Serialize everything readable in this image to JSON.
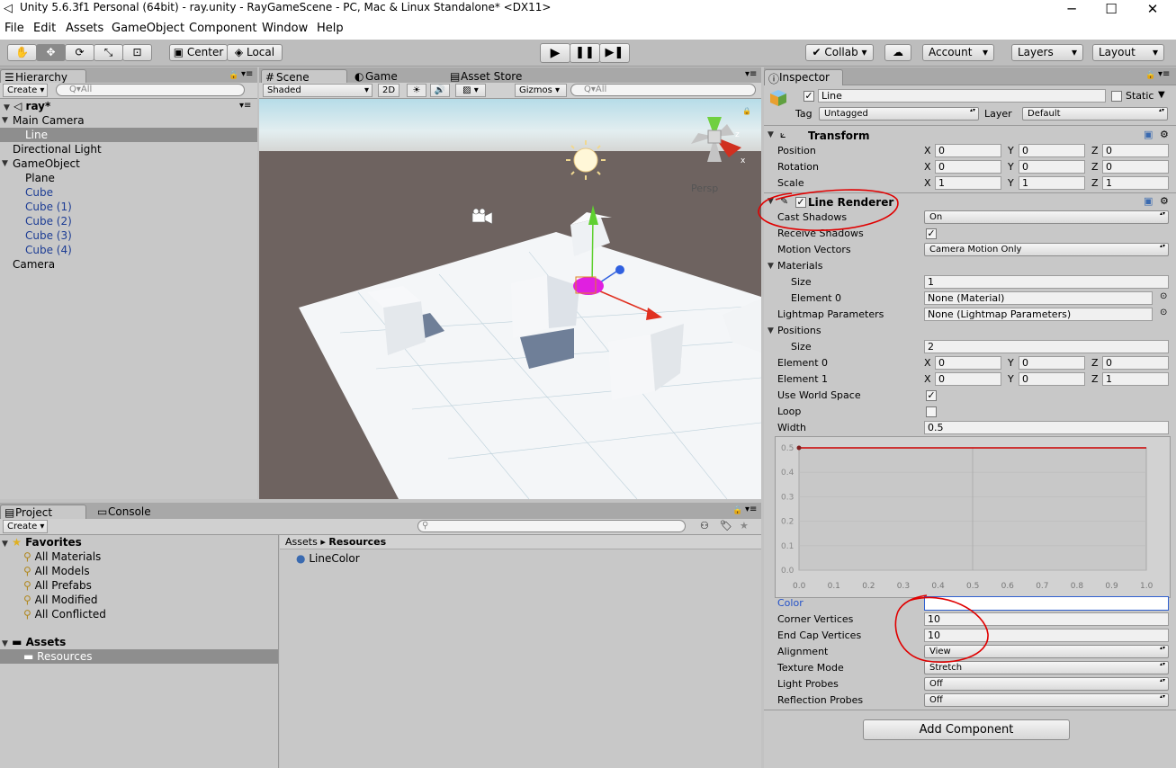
{
  "window": {
    "title": "Unity 5.6.3f1 Personal (64bit) - ray.unity - RayGameScene - PC, Mac & Linux Standalone* <DX11>",
    "minimize": "─",
    "maximize": "☐",
    "close": "✕"
  },
  "menu": [
    "File",
    "Edit",
    "Assets",
    "GameObject",
    "Component",
    "Window",
    "Help"
  ],
  "toolbar": {
    "center": "Center",
    "local": "Local",
    "collab": "Collab",
    "account": "Account",
    "layers": "Layers",
    "layout": "Layout"
  },
  "hierarchy": {
    "tab": "Hierarchy",
    "create": "Create",
    "search_placeholder": "Q▾All",
    "scene": "ray*",
    "items": [
      {
        "label": "Main Camera",
        "indent": 0,
        "expand": "open",
        "prefab": false,
        "selected": false
      },
      {
        "label": "Line",
        "indent": 1,
        "expand": "none",
        "prefab": false,
        "selected": true
      },
      {
        "label": "Directional Light",
        "indent": 0,
        "expand": "none",
        "prefab": false,
        "selected": false
      },
      {
        "label": "GameObject",
        "indent": 0,
        "expand": "open",
        "prefab": false,
        "selected": false
      },
      {
        "label": "Plane",
        "indent": 1,
        "expand": "none",
        "prefab": false,
        "selected": false
      },
      {
        "label": "Cube",
        "indent": 1,
        "expand": "none",
        "prefab": true,
        "selected": false
      },
      {
        "label": "Cube (1)",
        "indent": 1,
        "expand": "none",
        "prefab": true,
        "selected": false
      },
      {
        "label": "Cube (2)",
        "indent": 1,
        "expand": "none",
        "prefab": true,
        "selected": false
      },
      {
        "label": "Cube (3)",
        "indent": 1,
        "expand": "none",
        "prefab": true,
        "selected": false
      },
      {
        "label": "Cube (4)",
        "indent": 1,
        "expand": "none",
        "prefab": true,
        "selected": false
      },
      {
        "label": "Camera",
        "indent": 0,
        "expand": "none",
        "prefab": false,
        "selected": false
      }
    ]
  },
  "scene_tabs": {
    "scene": "Scene",
    "game": "Game",
    "asset_store": "Asset Store",
    "shaded": "Shaded",
    "mode_2d": "2D",
    "gizmos": "Gizmos",
    "search_placeholder": "Q▾All",
    "persp": "Persp",
    "gizmo_x": "x",
    "gizmo_z": "z"
  },
  "project": {
    "tab": "Project",
    "console_tab": "Console",
    "create": "Create",
    "favorites": "Favorites",
    "fav_items": [
      "All Materials",
      "All Models",
      "All Prefabs",
      "All Modified",
      "All Conflicted"
    ],
    "assets": "Assets",
    "resources": "Resources",
    "breadcrumb_root": "Assets",
    "breadcrumb_sep": "▸",
    "breadcrumb_current": "Resources",
    "files": [
      "LineColor"
    ]
  },
  "inspector": {
    "tab": "Inspector",
    "name": "Line",
    "static": "Static",
    "tag_label": "Tag",
    "tag_value": "Untagged",
    "layer_label": "Layer",
    "layer_value": "Default",
    "transform": {
      "title": "Transform",
      "rows": [
        {
          "label": "Position",
          "x": "0",
          "y": "0",
          "z": "0"
        },
        {
          "label": "Rotation",
          "x": "0",
          "y": "0",
          "z": "0"
        },
        {
          "label": "Scale",
          "x": "1",
          "y": "1",
          "z": "1"
        }
      ]
    },
    "line_renderer": {
      "title": "Line Renderer",
      "cast_shadows_label": "Cast Shadows",
      "cast_shadows": "On",
      "receive_shadows_label": "Receive Shadows",
      "receive_shadows": "✓",
      "motion_vectors_label": "Motion Vectors",
      "motion_vectors": "Camera Motion Only",
      "materials_label": "Materials",
      "size_label": "Size",
      "materials_size": "1",
      "element0_label": "Element 0",
      "element0_value": "None (Material)",
      "lightmap_label": "Lightmap Parameters",
      "lightmap_value": "None (Lightmap Parameters)",
      "positions_label": "Positions",
      "positions_size": "2",
      "pos_elements": [
        {
          "label": "Element 0",
          "x": "0",
          "y": "0",
          "z": "0"
        },
        {
          "label": "Element 1",
          "x": "0",
          "y": "0",
          "z": "1"
        }
      ],
      "use_world_space_label": "Use World Space",
      "use_world_space": "✓",
      "loop_label": "Loop",
      "width_label": "Width",
      "width_value": "0.5",
      "color_label": "Color",
      "corner_vertices_label": "Corner Vertices",
      "corner_vertices": "10",
      "end_cap_label": "End Cap Vertices",
      "end_cap": "10",
      "alignment_label": "Alignment",
      "alignment": "View",
      "texture_mode_label": "Texture Mode",
      "texture_mode": "Stretch",
      "light_probes_label": "Light Probes",
      "light_probes": "Off",
      "reflection_probes_label": "Reflection Probes",
      "reflection_probes": "Off"
    },
    "add_component": "Add Component"
  },
  "axis_labels": {
    "x": "X",
    "y": "Y",
    "z": "Z"
  },
  "chart_data": {
    "type": "line",
    "x": [
      0.0,
      1.0
    ],
    "y": [
      0.5,
      0.5
    ],
    "xticks": [
      "0.0",
      "0.1",
      "0.2",
      "0.3",
      "0.4",
      "0.5",
      "0.6",
      "0.7",
      "0.8",
      "0.9",
      "1.0"
    ],
    "yticks": [
      "0.0",
      "0.1",
      "0.2",
      "0.3",
      "0.4",
      "0.5"
    ],
    "xlim": [
      0,
      1
    ],
    "ylim": [
      0,
      0.5
    ],
    "line_color": "#cc0000"
  },
  "colors": {
    "annotation_circle": "#e00000",
    "selection": "#8e8e8e",
    "prefab_text": "#1c3c94"
  }
}
